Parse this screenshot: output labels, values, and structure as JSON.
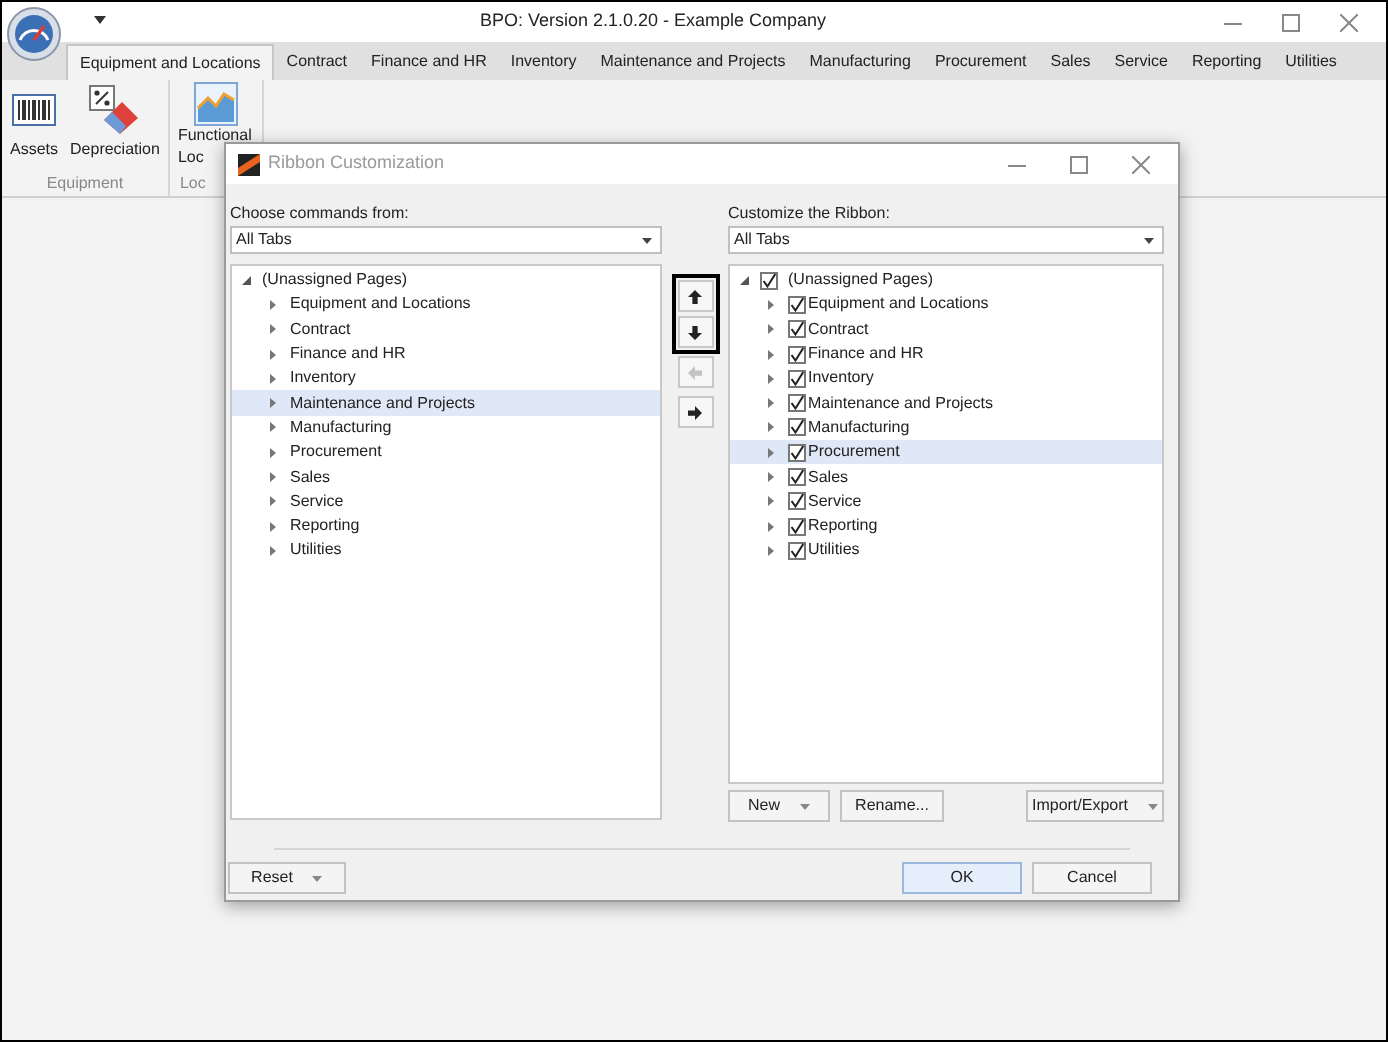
{
  "window": {
    "title": "BPO: Version 2.1.0.20 - Example Company"
  },
  "tabs": [
    {
      "label": "Equipment and Locations",
      "selected": true
    },
    {
      "label": "Contract",
      "selected": false
    },
    {
      "label": "Finance and HR",
      "selected": false
    },
    {
      "label": "Inventory",
      "selected": false
    },
    {
      "label": "Maintenance and Projects",
      "selected": false
    },
    {
      "label": "Manufacturing",
      "selected": false
    },
    {
      "label": "Procurement",
      "selected": false
    },
    {
      "label": "Sales",
      "selected": false
    },
    {
      "label": "Service",
      "selected": false
    },
    {
      "label": "Reporting",
      "selected": false
    },
    {
      "label": "Utilities",
      "selected": false
    }
  ],
  "ribbon": {
    "groups": [
      {
        "label": "Equipment",
        "items": [
          {
            "label": "Assets",
            "kind": "barcode"
          },
          {
            "label": "Depreciation",
            "kind": "percent"
          }
        ]
      },
      {
        "label": "Loc",
        "items": [
          {
            "label": "Functional Loc",
            "kind": "chart"
          }
        ]
      }
    ]
  },
  "dialog": {
    "title": "Ribbon Customization",
    "left_panel": {
      "label": "Choose commands from:",
      "dropdown": "All Tabs",
      "tree": {
        "label": "(Unassigned Pages)",
        "expanded": true,
        "children": [
          {
            "label": "Equipment and Locations",
            "selected": false
          },
          {
            "label": "Contract",
            "selected": false
          },
          {
            "label": "Finance and HR",
            "selected": false
          },
          {
            "label": "Inventory",
            "selected": false
          },
          {
            "label": "Maintenance and Projects",
            "selected": true
          },
          {
            "label": "Manufacturing",
            "selected": false
          },
          {
            "label": "Procurement",
            "selected": false
          },
          {
            "label": "Sales",
            "selected": false
          },
          {
            "label": "Service",
            "selected": false
          },
          {
            "label": "Reporting",
            "selected": false
          },
          {
            "label": "Utilities",
            "selected": false
          }
        ]
      }
    },
    "move_buttons": [
      {
        "kind": "up",
        "disabled": false
      },
      {
        "kind": "down",
        "disabled": false
      },
      {
        "kind": "left",
        "disabled": true
      },
      {
        "kind": "right",
        "disabled": false
      }
    ],
    "right_panel": {
      "label": "Customize the Ribbon:",
      "dropdown": "All Tabs",
      "tree": {
        "label": "(Unassigned Pages)",
        "expanded": true,
        "checked": true,
        "children": [
          {
            "label": "Equipment and Locations",
            "selected": false,
            "checked": true
          },
          {
            "label": "Contract",
            "selected": false,
            "checked": true
          },
          {
            "label": "Finance and HR",
            "selected": false,
            "checked": true
          },
          {
            "label": "Inventory",
            "selected": false,
            "checked": true
          },
          {
            "label": "Maintenance and Projects",
            "selected": false,
            "checked": true
          },
          {
            "label": "Manufacturing",
            "selected": false,
            "checked": true
          },
          {
            "label": "Procurement",
            "selected": true,
            "checked": true
          },
          {
            "label": "Sales",
            "selected": false,
            "checked": true
          },
          {
            "label": "Service",
            "selected": false,
            "checked": true
          },
          {
            "label": "Reporting",
            "selected": false,
            "checked": true
          },
          {
            "label": "Utilities",
            "selected": false,
            "checked": true
          }
        ]
      },
      "buttons": [
        {
          "label": "New",
          "dropdown": true
        },
        {
          "label": "Rename...",
          "dropdown": false
        },
        {
          "label": "Import/Export",
          "dropdown": true
        }
      ]
    },
    "footer": {
      "left": [
        {
          "label": "Reset",
          "dropdown": true
        }
      ],
      "right": [
        {
          "label": "OK",
          "default": true
        },
        {
          "label": "Cancel",
          "default": false
        }
      ]
    }
  }
}
